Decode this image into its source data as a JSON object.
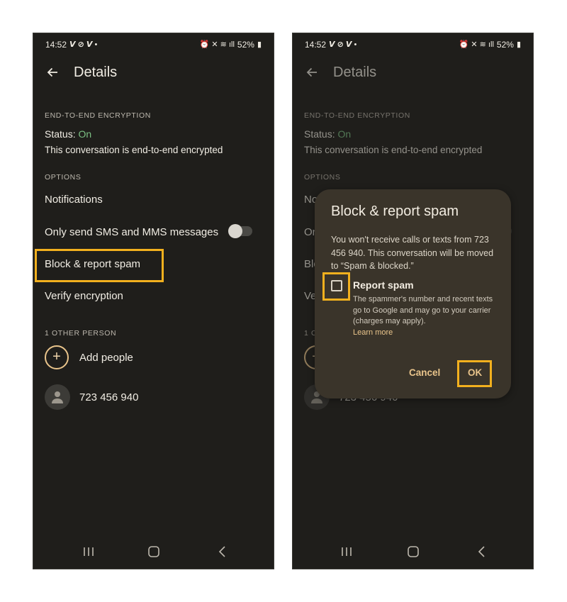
{
  "status_bar": {
    "time": "14:52",
    "battery": "52%"
  },
  "header": {
    "title": "Details"
  },
  "encryption": {
    "section_label": "END-TO-END ENCRYPTION",
    "status_prefix": "Status: ",
    "status_value": "On",
    "description": "This conversation is end-to-end encrypted"
  },
  "options": {
    "section_label": "OPTIONS",
    "notifications": "Notifications",
    "sms_only": "Only send SMS and MMS messages",
    "sms_only_enabled": false,
    "block_report": "Block & report spam",
    "verify": "Verify encryption"
  },
  "people": {
    "section_label": "1 OTHER PERSON",
    "add_people": "Add people",
    "contact": "723 456 940"
  },
  "dialog": {
    "title": "Block & report spam",
    "body": "You won't receive calls or texts from 723 456 940. This conversation will be moved to “Spam & blocked.”",
    "checkbox_label": "Report spam",
    "checkbox_checked": false,
    "checkbox_description": "The spammer's number and recent texts go to Google and may go to your carrier (charges may apply).",
    "learn_more": "Learn more",
    "cancel": "Cancel",
    "ok": "OK"
  },
  "colors": {
    "highlight": "#f2b01e",
    "accent": "#e9c48b",
    "status_on": "#7bbf83",
    "background": "#1f1e1b"
  },
  "icons": [
    "back-arrow-icon",
    "toggle-switch",
    "plus-icon",
    "person-icon",
    "checkbox-icon",
    "recents-icon",
    "home-icon",
    "back-nav-icon"
  ]
}
